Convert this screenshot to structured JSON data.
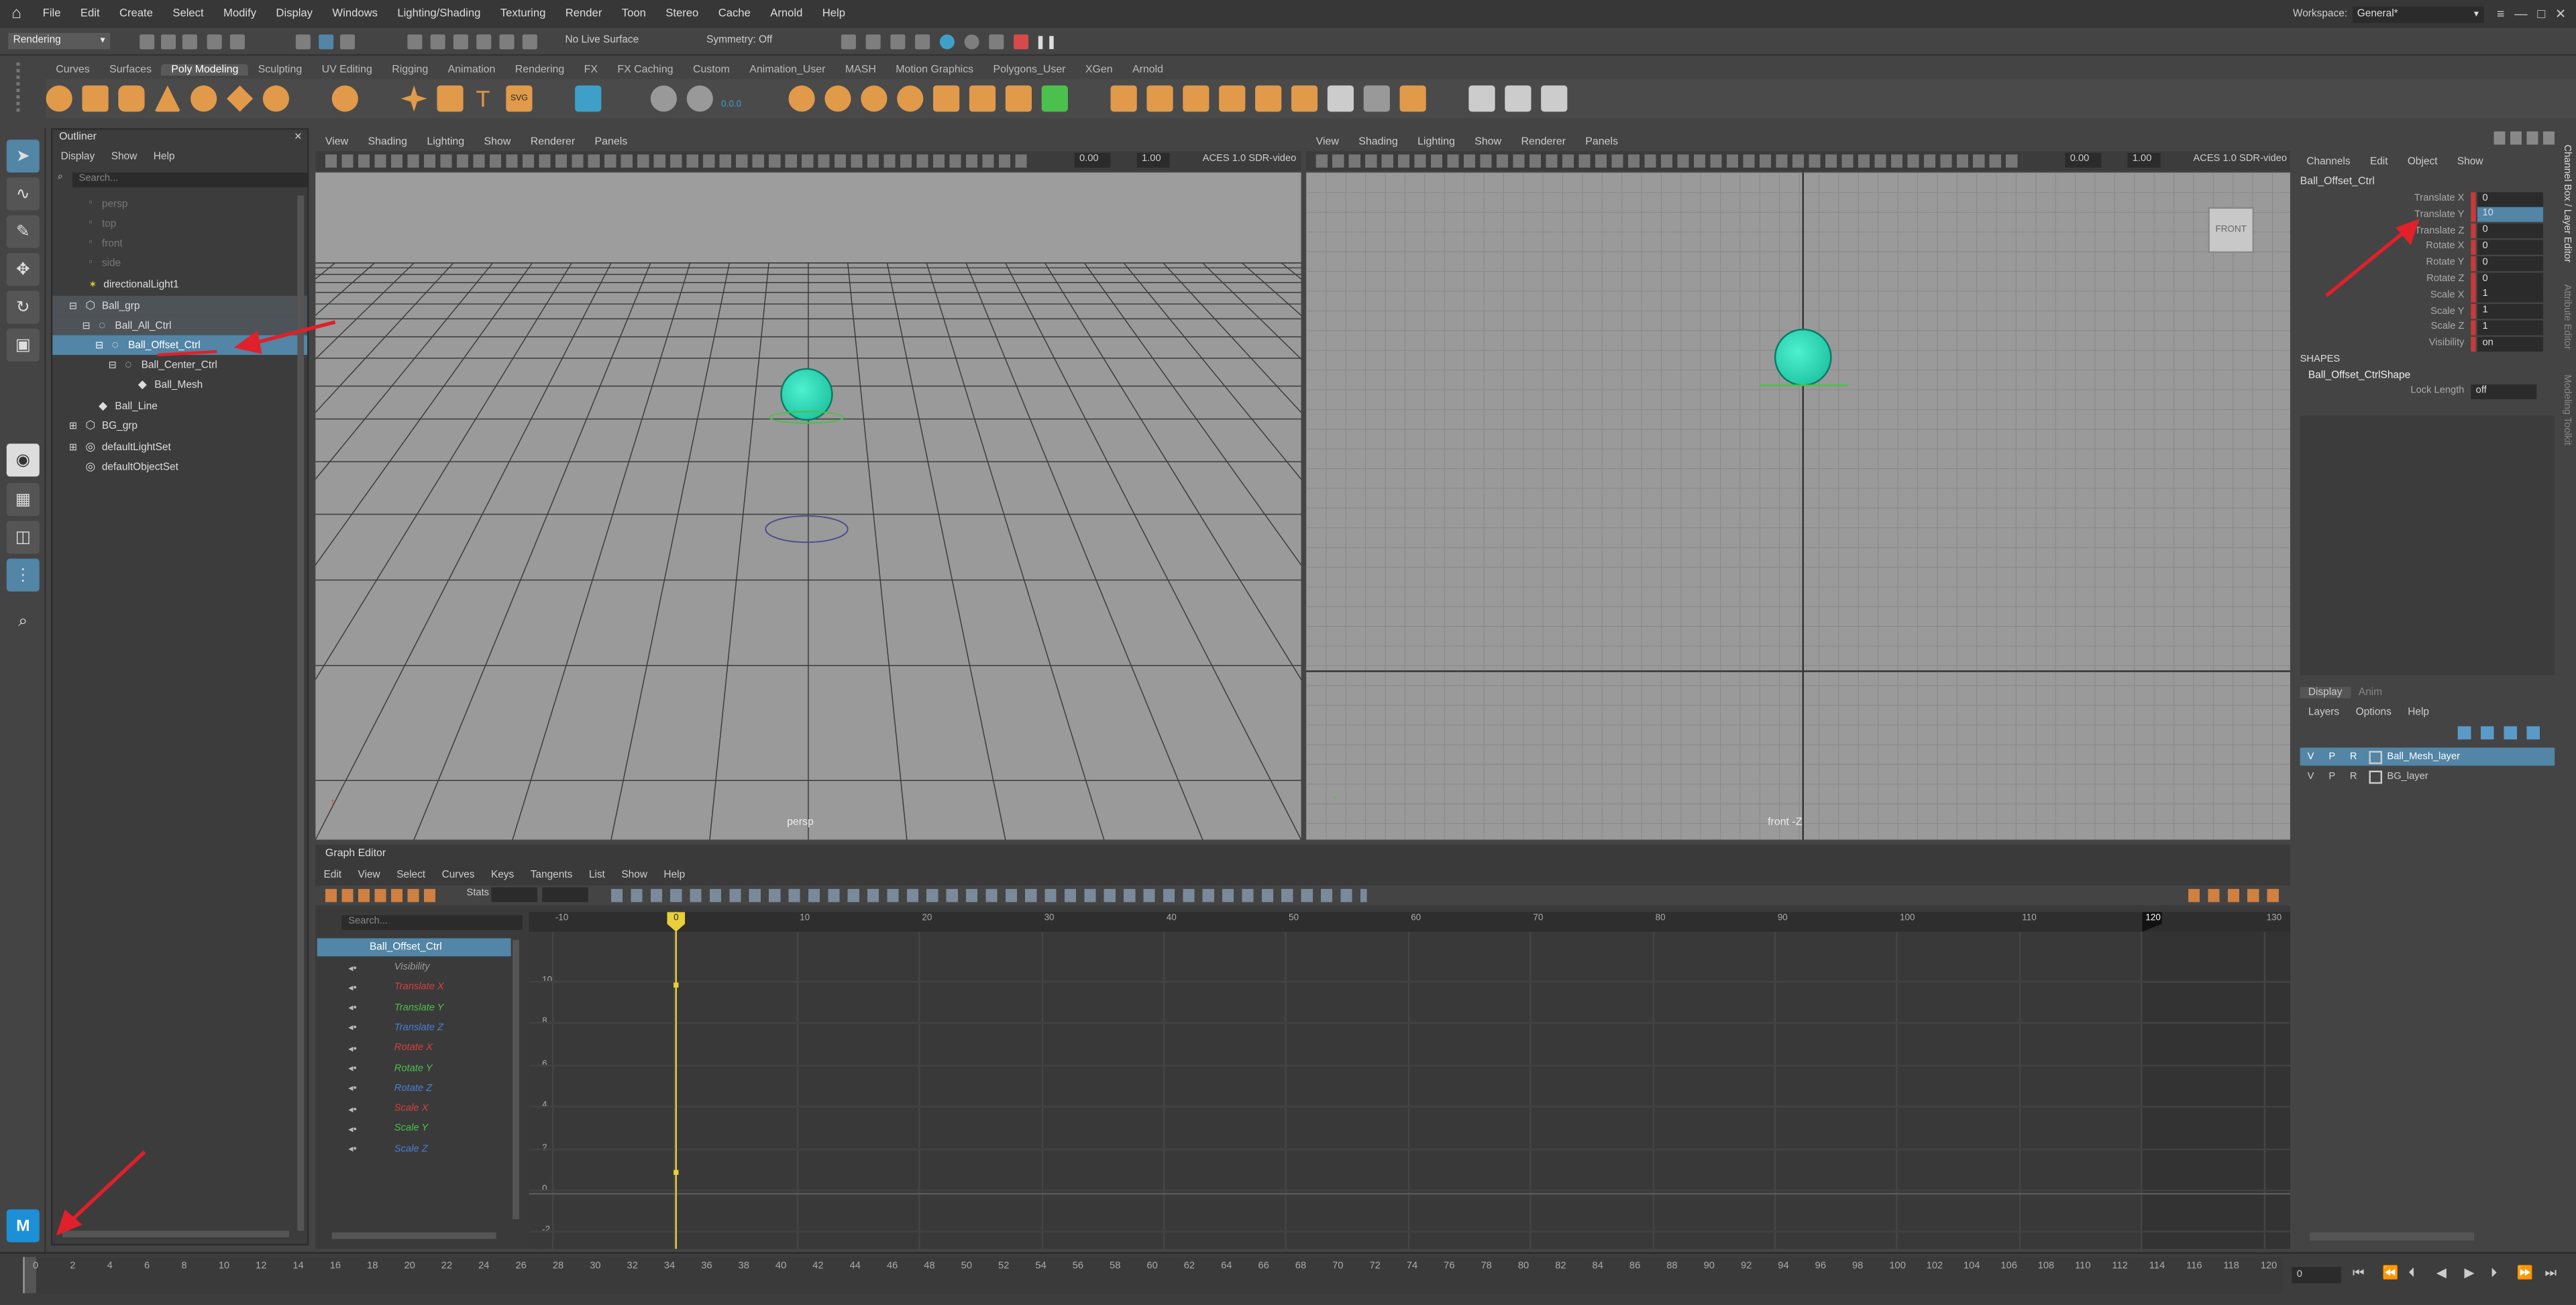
{
  "menubar": {
    "items": [
      "File",
      "Edit",
      "Create",
      "Select",
      "Modify",
      "Display",
      "Windows",
      "Lighting/Shading",
      "Texturing",
      "Render",
      "Toon",
      "Stereo",
      "Cache",
      "Arnold",
      "Help"
    ],
    "workspace_label": "Workspace:",
    "workspace_value": "General*"
  },
  "statusline": {
    "menuset": "Rendering",
    "live_surface": "No Live Surface",
    "symmetry": "Symmetry: Off"
  },
  "shelf": {
    "tabs": [
      "Curves",
      "Surfaces",
      "Poly Modeling",
      "Sculpting",
      "UV Editing",
      "Rigging",
      "Animation",
      "Rendering",
      "FX",
      "FX Caching",
      "Custom",
      "Animation_User",
      "MASH",
      "Motion Graphics",
      "Polygons_User",
      "XGen",
      "Arnold"
    ],
    "active_tab": "Poly Modeling",
    "icon_label": "0.0.0"
  },
  "outliner": {
    "title": "Outliner",
    "menu": [
      "Display",
      "Show",
      "Help"
    ],
    "search_placeholder": "Search...",
    "rows": [
      "persp",
      "top",
      "front",
      "side",
      "directionalLight1",
      "Ball_grp",
      "Ball_All_Ctrl",
      "Ball_Offset_Ctrl",
      "Ball_Center_Ctrl",
      "Ball_Mesh",
      "Ball_Line",
      "BG_grp",
      "defaultLightSet",
      "defaultObjectSet"
    ]
  },
  "viewport_left": {
    "menu": [
      "View",
      "Shading",
      "Lighting",
      "Show",
      "Renderer",
      "Panels"
    ],
    "field1": "0.00",
    "field2": "1.00",
    "colorspace": "ACES 1.0 SDR-video",
    "camera_label": "persp"
  },
  "viewport_right": {
    "menu": [
      "View",
      "Shading",
      "Lighting",
      "Show",
      "Renderer",
      "Panels"
    ],
    "field1": "0.00",
    "field2": "1.00",
    "colorspace": "ACES 1.0 SDR-video",
    "camera_label": "front -Z",
    "cube_label": "FRONT"
  },
  "graph_editor": {
    "title": "Graph Editor",
    "menu": [
      "Edit",
      "View",
      "Select",
      "Curves",
      "Keys",
      "Tangents",
      "List",
      "Show",
      "Help"
    ],
    "stats_label": "Stats",
    "search_placeholder": "Search...",
    "object": "Ball_Offset_Ctrl",
    "channels": [
      {
        "name": "Visibility",
        "color": "#9a9a9a"
      },
      {
        "name": "Translate X",
        "color": "#d64040"
      },
      {
        "name": "Translate Y",
        "color": "#4cc04c"
      },
      {
        "name": "Translate Z",
        "color": "#4a7fd8"
      },
      {
        "name": "Rotate X",
        "color": "#d64040"
      },
      {
        "name": "Rotate Y",
        "color": "#4cc04c"
      },
      {
        "name": "Rotate Z",
        "color": "#4a7fd8"
      },
      {
        "name": "Scale X",
        "color": "#d64040"
      },
      {
        "name": "Scale Y",
        "color": "#4cc04c"
      },
      {
        "name": "Scale Z",
        "color": "#4a7fd8"
      }
    ],
    "frame_ticks": [
      "-10",
      "0",
      "10",
      "20",
      "30",
      "40",
      "50",
      "60",
      "70",
      "80",
      "90",
      "100",
      "110",
      "120",
      "130"
    ],
    "value_ticks": [
      "10",
      "8",
      "6",
      "4",
      "2",
      "0",
      "-2"
    ],
    "current_frame": "0",
    "end_frame": "120"
  },
  "channel_box": {
    "tabs": [
      "Channels",
      "Edit",
      "Object",
      "Show"
    ],
    "object": "Ball_Offset_Ctrl",
    "attributes": [
      {
        "name": "Translate X",
        "value": "0"
      },
      {
        "name": "Translate Y",
        "value": "10"
      },
      {
        "name": "Translate Z",
        "value": "0"
      },
      {
        "name": "Rotate X",
        "value": "0"
      },
      {
        "name": "Rotate Y",
        "value": "0"
      },
      {
        "name": "Rotate Z",
        "value": "0"
      },
      {
        "name": "Scale X",
        "value": "1"
      },
      {
        "name": "Scale Y",
        "value": "1"
      },
      {
        "name": "Scale Z",
        "value": "1"
      },
      {
        "name": "Visibility",
        "value": "on"
      }
    ],
    "shapes_header": "SHAPES",
    "shape_name": "Ball_Offset_CtrlShape",
    "lock_length_label": "Lock Length",
    "lock_length_value": "off",
    "side_tabs": [
      "Channel Box / Layer Editor",
      "Attribute Editor",
      "Modeling Toolkit"
    ]
  },
  "layer_editor": {
    "tabs": [
      "Display",
      "Anim"
    ],
    "menu": [
      "Layers",
      "Options",
      "Help"
    ],
    "layers": [
      {
        "v": "V",
        "p": "P",
        "r": "R",
        "name": "Ball_Mesh_layer"
      },
      {
        "v": "V",
        "p": "P",
        "r": "R",
        "name": "BG_layer"
      }
    ]
  },
  "timeline": {
    "ticks": [
      "0",
      "2",
      "4",
      "6",
      "8",
      "10",
      "12",
      "14",
      "16",
      "18",
      "20",
      "22",
      "24",
      "26",
      "28",
      "30",
      "32",
      "34",
      "36",
      "38",
      "40",
      "42",
      "44",
      "46",
      "48",
      "50",
      "52",
      "54",
      "56",
      "58",
      "60",
      "62",
      "64",
      "66",
      "68",
      "70",
      "72",
      "74",
      "76",
      "78",
      "80",
      "82",
      "84",
      "86",
      "88",
      "90",
      "92",
      "94",
      "96",
      "98",
      "100",
      "102",
      "104",
      "106",
      "108",
      "110",
      "112",
      "114",
      "116",
      "118",
      "120"
    ],
    "current": "0",
    "frame_field": "0"
  },
  "logo": {
    "letter": "M"
  },
  "colors": {
    "selection": "#5285a6",
    "annotation_arrow": "#e0202a",
    "ball": "#1fd4b0",
    "playhead": "#e8d03a"
  }
}
